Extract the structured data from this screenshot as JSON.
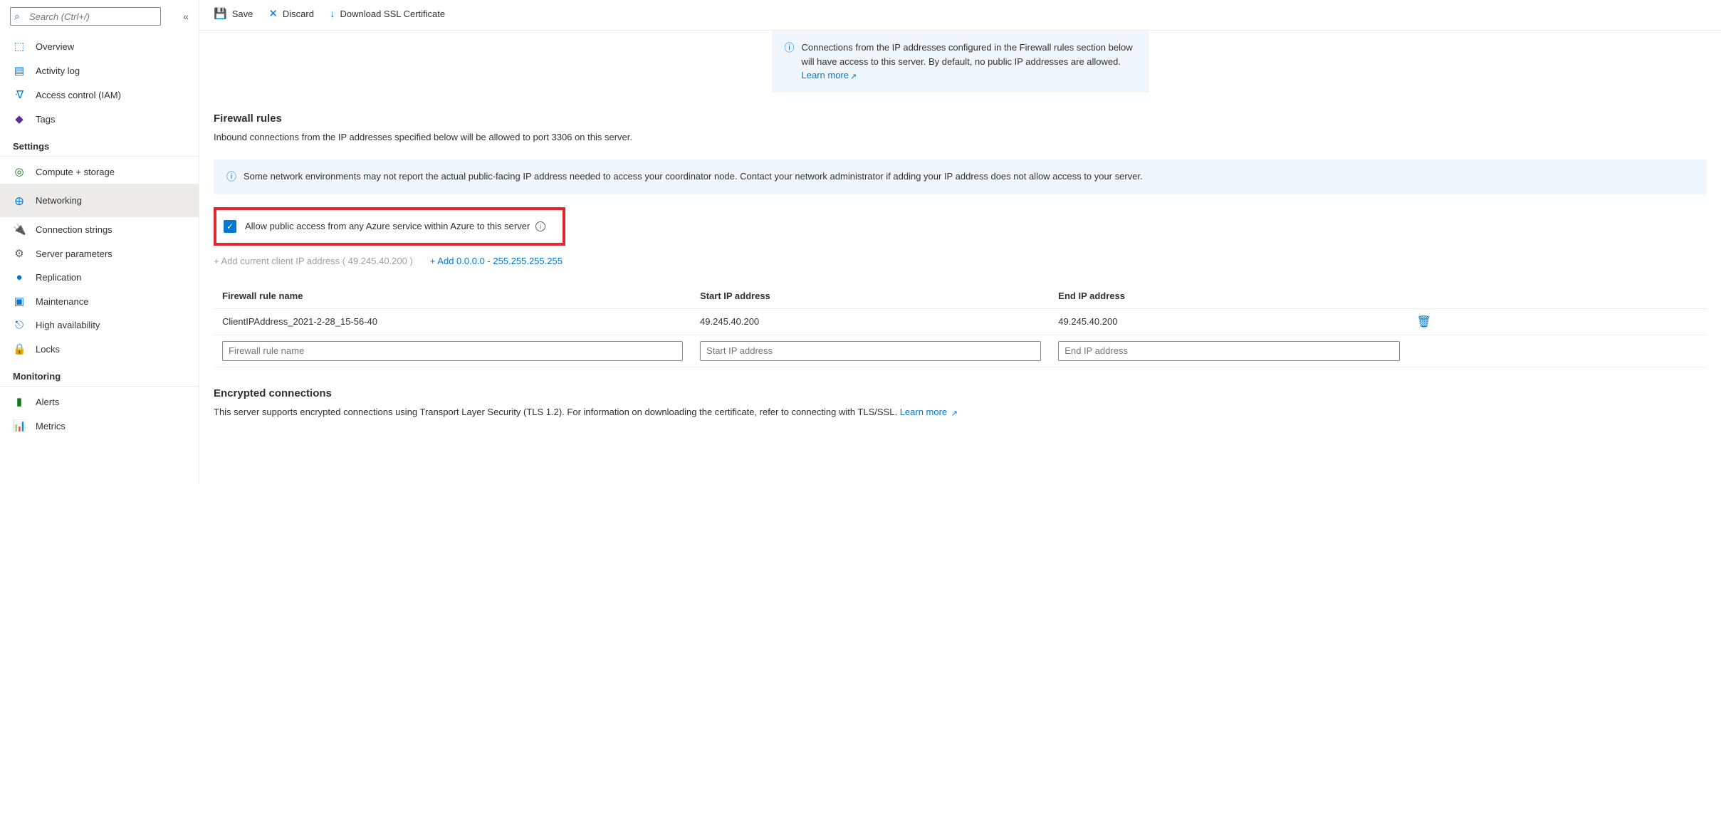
{
  "sidebar": {
    "search_placeholder": "Search (Ctrl+/)",
    "items_top": [
      {
        "icon": "⬚",
        "label": "Overview",
        "color": "#0078d4"
      },
      {
        "icon": "▤",
        "label": "Activity log",
        "color": "#0078d4"
      },
      {
        "icon": "ᐌ",
        "label": "Access control (IAM)",
        "color": "#0078d4"
      },
      {
        "icon": "◆",
        "label": "Tags",
        "color": "#5c2e91"
      }
    ],
    "section_settings": "Settings",
    "items_settings": [
      {
        "icon": "◎",
        "label": "Compute + storage",
        "color": "#107c10"
      },
      {
        "icon": "🜨",
        "label": "Networking",
        "color": "#0078d4",
        "active": true
      },
      {
        "icon": "🔌",
        "label": "Connection strings",
        "color": "#605e5c"
      },
      {
        "icon": "⚙",
        "label": "Server parameters",
        "color": "#605e5c"
      },
      {
        "icon": "●",
        "label": "Replication",
        "color": "#0078d4"
      },
      {
        "icon": "▣",
        "label": "Maintenance",
        "color": "#0078d4"
      },
      {
        "icon": "⎋",
        "label": "High availability",
        "color": "#0078d4"
      },
      {
        "icon": "🔒",
        "label": "Locks",
        "color": "#0078d4"
      }
    ],
    "section_monitoring": "Monitoring",
    "items_monitoring": [
      {
        "icon": "▮",
        "label": "Alerts",
        "color": "#107c10"
      },
      {
        "icon": "📊",
        "label": "Metrics",
        "color": "#0078d4"
      }
    ]
  },
  "toolbar": {
    "save": "Save",
    "discard": "Discard",
    "download": "Download SSL Certificate"
  },
  "content": {
    "info_top": "Connections from the IP addresses configured in the Firewall rules section below will have access to this server. By default, no public IP addresses are allowed. ",
    "learn_more": "Learn more",
    "firewall_heading": "Firewall rules",
    "firewall_desc": "Inbound connections from the IP addresses specified below will be allowed to port 3306 on this server.",
    "info_wide": "Some network environments may not report the actual public-facing IP address needed to access your coordinator node. Contact your network administrator if adding your IP address does not allow access to your server.",
    "checkbox_label": "Allow public access from any Azure service within Azure to this server",
    "add_current": "+ Add current client IP address ( 49.245.40.200 )",
    "add_range": "+ Add 0.0.0.0 - 255.255.255.255",
    "table": {
      "h_name": "Firewall rule name",
      "h_start": "Start IP address",
      "h_end": "End IP address",
      "row_name": "ClientIPAddress_2021-2-28_15-56-40",
      "row_start": "49.245.40.200",
      "row_end": "49.245.40.200",
      "ph_name": "Firewall rule name",
      "ph_start": "Start IP address",
      "ph_end": "End IP address"
    },
    "enc_heading": "Encrypted connections",
    "enc_desc": "This server supports encrypted connections using Transport Layer Security (TLS 1.2). For information on downloading the certificate, refer to connecting with TLS/SSL. "
  }
}
